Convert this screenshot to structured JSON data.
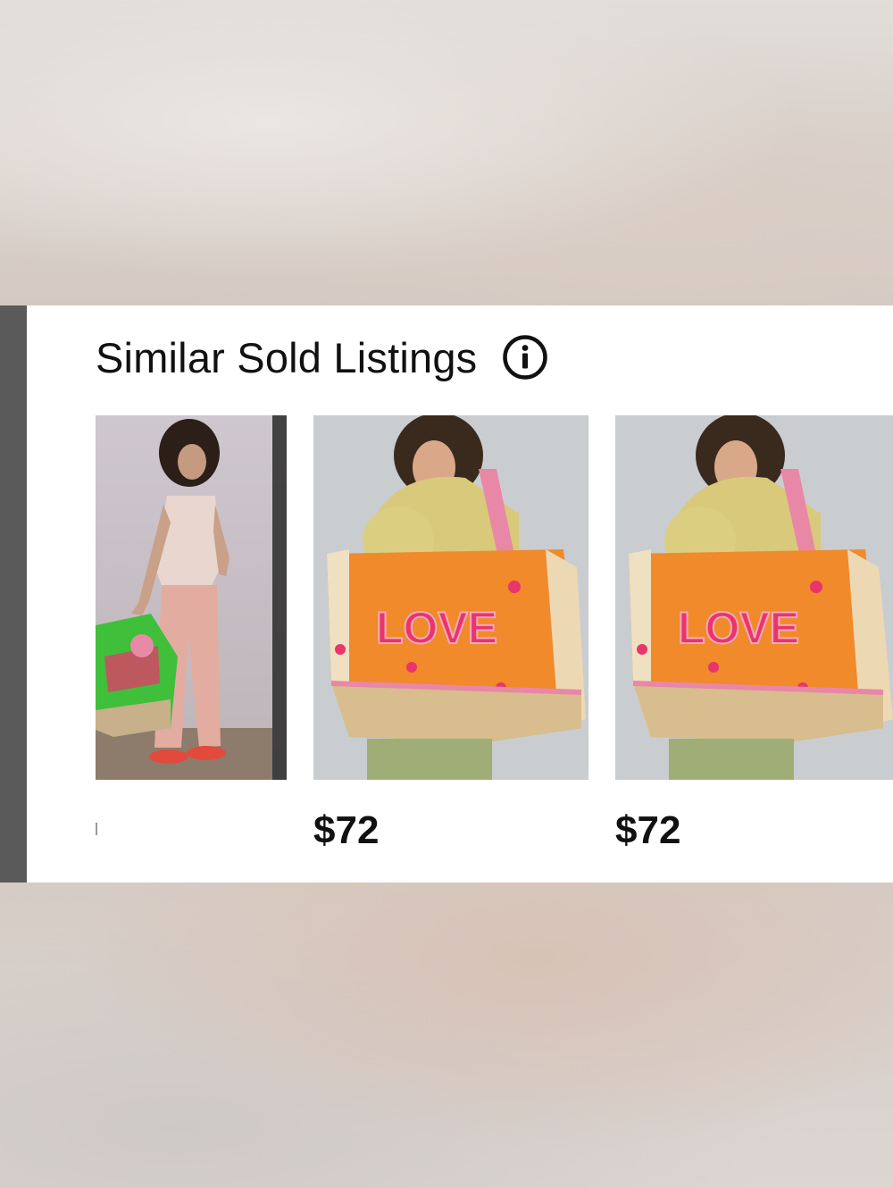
{
  "section": {
    "title": "Similar Sold Listings",
    "info_icon": "info-circle-icon"
  },
  "listings": [
    {
      "price": ""
    },
    {
      "price": "$72"
    },
    {
      "price": "$72"
    }
  ],
  "colors": {
    "panel_bg": "#ffffff",
    "text": "#111111",
    "left_edge": "#5a5a5a",
    "bag_orange": "#f08a2a",
    "bag_pink": "#e8356b",
    "bag_green": "#3fbf3a",
    "sweater_yellow": "#d9c97a"
  }
}
